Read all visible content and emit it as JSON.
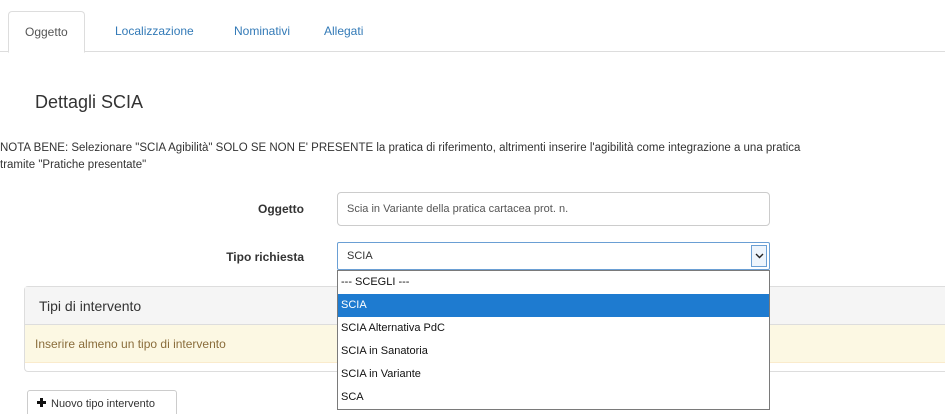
{
  "tabs": [
    {
      "label": "Oggetto",
      "active": true
    },
    {
      "label": "Localizzazione",
      "active": false
    },
    {
      "label": "Nominativi",
      "active": false
    },
    {
      "label": "Allegati",
      "active": false
    }
  ],
  "section_title": "Dettagli SCIA",
  "nota": {
    "line1": "NOTA BENE: Selezionare \"SCIA Agibilità\" SOLO SE NON E' PRESENTE la pratica di riferimento, altrimenti inserire l'agibilità come integrazione a una pratica",
    "line2": "tramite \"Pratiche presentate\""
  },
  "form": {
    "oggetto_label": "Oggetto",
    "oggetto_value": "Scia in Variante della pratica cartacea prot. n.",
    "tipo_label": "Tipo richiesta",
    "tipo_value": "SCIA"
  },
  "dropdown": {
    "options": [
      "--- SCEGLI ---",
      "SCIA",
      "SCIA Alternativa PdC",
      "SCIA in Sanatoria",
      "SCIA in Variante",
      "SCA"
    ],
    "selected": "SCIA"
  },
  "panel": {
    "title": "Tipi di intervento",
    "warning": "Inserire almeno un tipo di intervento"
  },
  "add_button_label": "Nuovo tipo intervento",
  "colors": {
    "link": "#337ab7",
    "selected_option": "#1e7bd0",
    "warning_bg": "#fcf8e3",
    "warning_text": "#8a6d3b"
  }
}
